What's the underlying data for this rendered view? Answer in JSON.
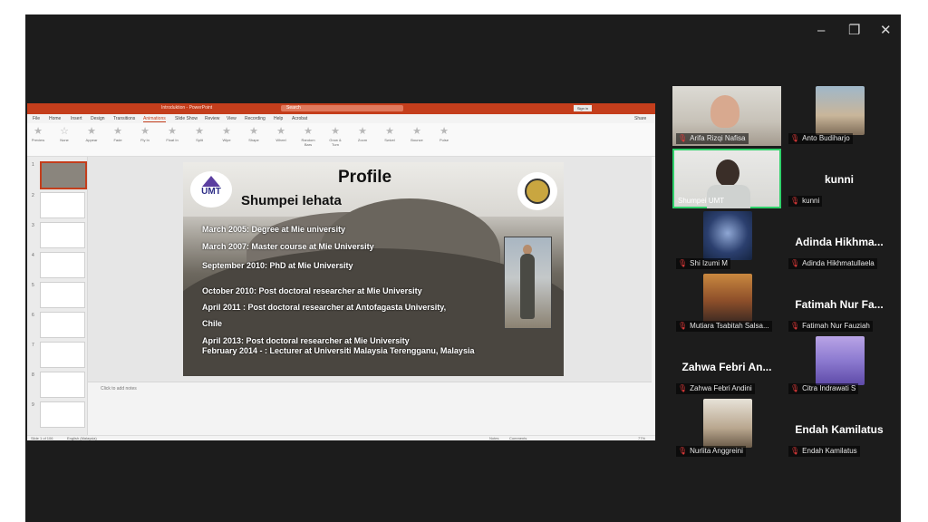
{
  "window": {
    "minimize": "–",
    "restore": "❐",
    "close": "✕"
  },
  "ppt": {
    "title": "Introduktion - PowerPoint",
    "search": "Search",
    "signin": "Sign in",
    "tabs": [
      "File",
      "Home",
      "Insert",
      "Design",
      "Transitions",
      "Animations",
      "Slide Show",
      "Review",
      "View",
      "Recording",
      "Help",
      "Acrobat"
    ],
    "active_tab": "Animations",
    "share": "Share",
    "ribbon": [
      "Preview",
      "None",
      "Appear",
      "Fade",
      "Fly In",
      "Float In",
      "Split",
      "Wipe",
      "Shape",
      "Wheel",
      "Random Bars",
      "Grow & Turn",
      "Zoom",
      "Swivel",
      "Bounce",
      "Pulse"
    ],
    "notes_placeholder": "Click to add notes",
    "status_left": "Slide 1 of 106",
    "status_lang": "English (Malaysia)",
    "status_notes": "Notes",
    "status_comments": "Comments",
    "zoom": "77%"
  },
  "slide": {
    "title": "Profile",
    "name": "Shumpei Iehata",
    "logo_left": "UMT",
    "lines": [
      "March 2005: Degree at Mie university",
      "March 2007: Master course at Mie University",
      "September 2010: PhD at Mie University",
      "October 2010: Post doctoral researcher at Mie University",
      "April 2011 : Post doctoral researcher at Antofagasta University,",
      "Chile",
      "April 2013: Post doctoral researcher at Mie University",
      "February 2014 - : Lecturer at Universiti Malaysia Terengganu, Malaysia"
    ]
  },
  "participants": [
    {
      "tag": "Arifa Rizqi Nafisa",
      "big": ""
    },
    {
      "tag": "Anto Budiharjo",
      "big": ""
    },
    {
      "tag": "Shumpei UMT",
      "big": ""
    },
    {
      "tag": "kunni",
      "big": "kunni"
    },
    {
      "tag": "Shi Izumi M",
      "big": ""
    },
    {
      "tag": "Adinda Hikhmatullaela",
      "big": "Adinda Hikhma..."
    },
    {
      "tag": "Mutiara Tsabitah Salsa...",
      "big": ""
    },
    {
      "tag": "Fatimah Nur Fauziah",
      "big": "Fatimah Nur Fa..."
    },
    {
      "tag": "Zahwa Febri Andini",
      "big": "Zahwa Febri An..."
    },
    {
      "tag": "Citra Indrawati S",
      "big": ""
    },
    {
      "tag": "Nurlita Anggreini",
      "big": ""
    },
    {
      "tag": "Endah Kamilatus",
      "big": "Endah Kamilatus"
    }
  ],
  "colors": {
    "accent": "#c43e1c",
    "active_speaker": "#2fd16a",
    "mic_muted": "#e23a3a"
  }
}
